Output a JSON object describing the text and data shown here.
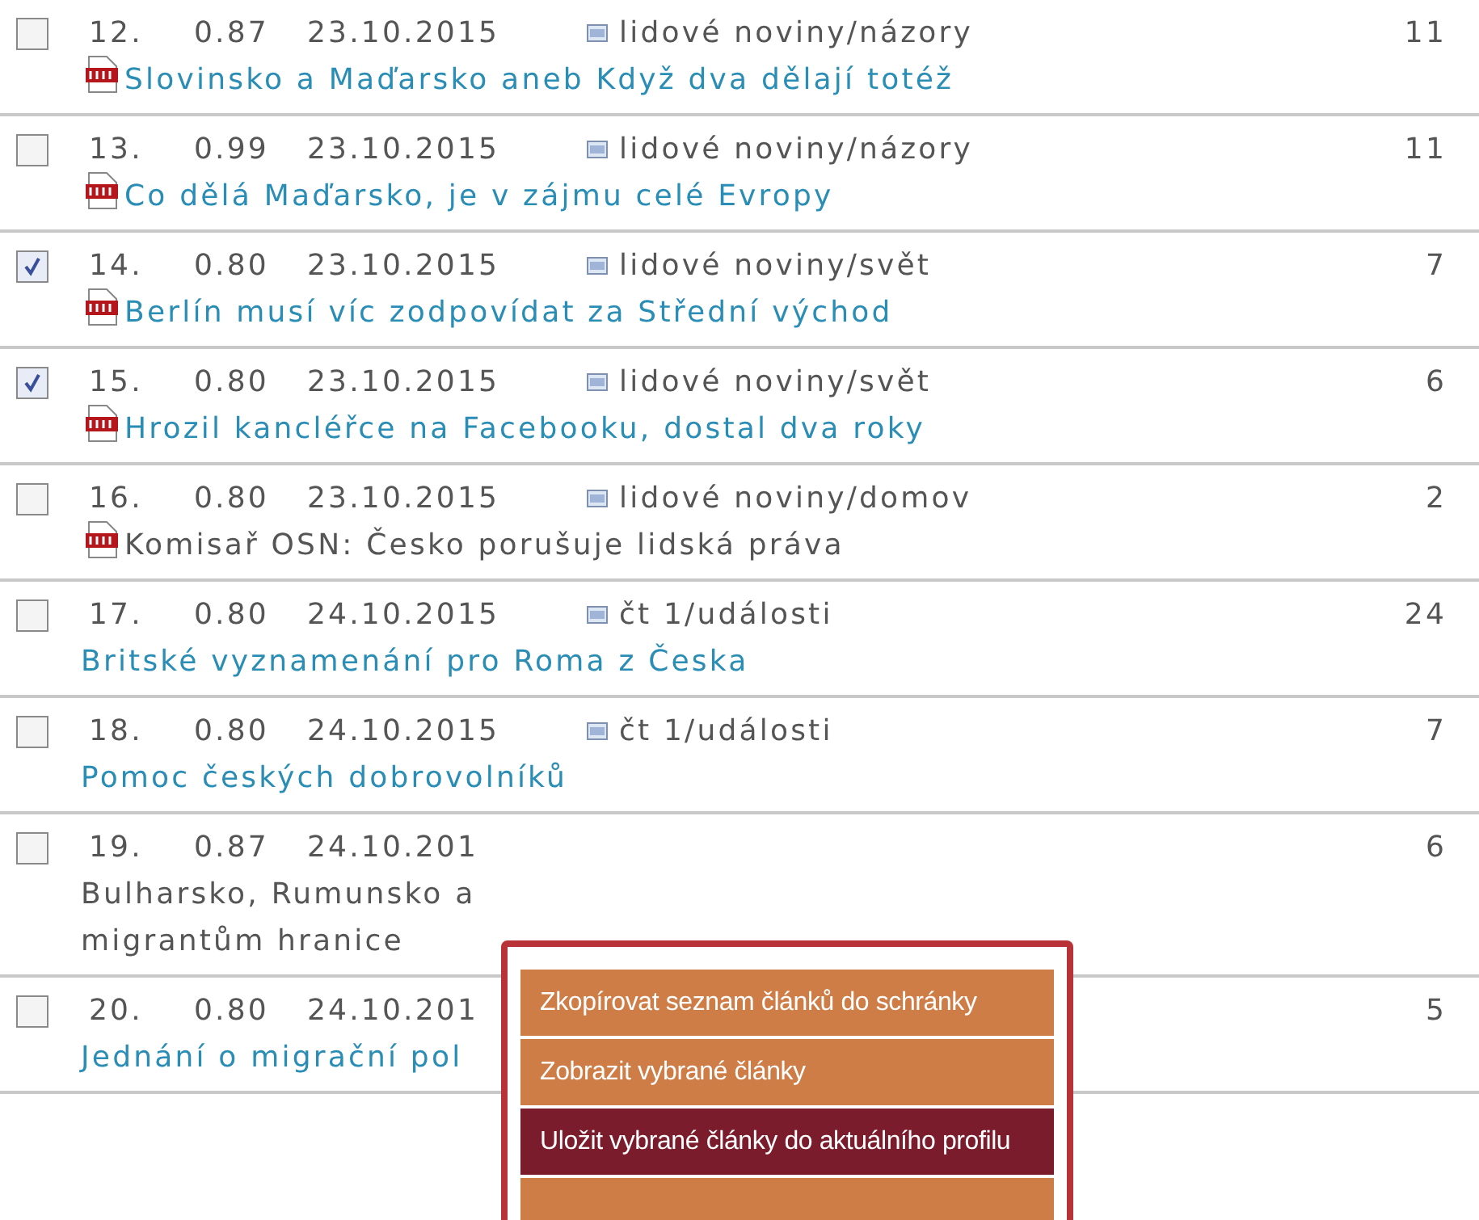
{
  "rows": [
    {
      "checked": false,
      "number": "12.",
      "score": "0.87",
      "date": "23.10.2015",
      "source": "lidové noviny/názory",
      "count": "11",
      "attachment": true,
      "kind": "link",
      "title_lines": [
        "Slovinsko a Maďarsko aneb Když dva dělají totéž"
      ]
    },
    {
      "checked": false,
      "number": "13.",
      "score": "0.99",
      "date": "23.10.2015",
      "source": "lidové noviny/názory",
      "count": "11",
      "attachment": true,
      "kind": "link",
      "title_lines": [
        "Co dělá Maďarsko, je v zájmu celé Evropy"
      ]
    },
    {
      "checked": true,
      "number": "14.",
      "score": "0.80",
      "date": "23.10.2015",
      "source": "lidové noviny/svět",
      "count": "7",
      "attachment": true,
      "kind": "link",
      "title_lines": [
        "Berlín musí víc zodpovídat za Střední východ"
      ]
    },
    {
      "checked": true,
      "number": "15.",
      "score": "0.80",
      "date": "23.10.2015",
      "source": "lidové noviny/svět",
      "count": "6",
      "attachment": true,
      "kind": "link",
      "title_lines": [
        "Hrozil kancléřce na Facebooku, dostal dva roky"
      ]
    },
    {
      "checked": false,
      "number": "16.",
      "score": "0.80",
      "date": "23.10.2015",
      "source": "lidové noviny/domov",
      "count": "2",
      "attachment": true,
      "kind": "plain",
      "title_lines": [
        "Komisař OSN: Česko porušuje lidská práva"
      ]
    },
    {
      "checked": false,
      "number": "17.",
      "score": "0.80",
      "date": "24.10.2015",
      "source": "čt 1/události",
      "count": "24",
      "attachment": false,
      "kind": "link",
      "title_lines": [
        "Britské vyznamenání pro Roma z Česka"
      ]
    },
    {
      "checked": false,
      "number": "18.",
      "score": "0.80",
      "date": "24.10.2015",
      "source": "čt 1/události",
      "count": "7",
      "attachment": false,
      "kind": "link",
      "title_lines": [
        "Pomoc českých dobrovolníků"
      ]
    },
    {
      "checked": false,
      "number": "19.",
      "score": "0.87",
      "date": "24.10.201",
      "count": "6",
      "attachment": false,
      "kind": "plain",
      "title_lines": [
        "Bulharsko, Rumunsko a",
        "migrantům hranice"
      ]
    },
    {
      "checked": false,
      "number": "20.",
      "score": "0.80",
      "date": "24.10.201",
      "count": "5",
      "attachment": false,
      "kind": "link",
      "title_lines": [
        "Jednání o migrační pol"
      ]
    }
  ],
  "context_menu": {
    "items": [
      {
        "label": "Zkopírovat seznam článků do schránky",
        "selected": false
      },
      {
        "label": "Zobrazit vybrané články",
        "selected": false
      },
      {
        "label": "Uložit vybrané články do aktuálního profilu",
        "selected": true
      }
    ]
  }
}
